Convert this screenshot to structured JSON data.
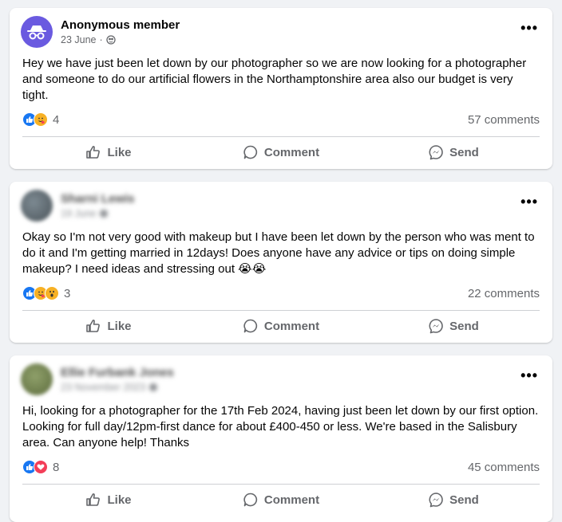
{
  "posts": [
    {
      "author": "Anonymous member",
      "date": "23 June",
      "body": "Hey we have just been let down by our photographer so we are now looking for a photographer and someone to do our artificial flowers in the Northamptonshire area also our budget is very tight.",
      "reaction_count": "4",
      "comments": "57 comments"
    },
    {
      "author": "Sharni Lewis",
      "date": "19 June",
      "body": "Okay so I'm not very good with makeup but I have been let down by the person who was ment to do it and I'm getting married in 12days! Does anyone have any advice or tips on doing simple makeup? I need ideas and stressing out 😭😭",
      "reaction_count": "3",
      "comments": "22 comments"
    },
    {
      "author": "Ellie Furbank Jones",
      "date": "23 November 2023",
      "body": "Hi, looking for a photographer for the 17th Feb 2024, having just been let down by our first option. Looking for full day/12pm-first dance for about £400-450 or less. We're based in the Salisbury area. Can anyone help! Thanks",
      "reaction_count": "8",
      "comments": "45 comments"
    }
  ],
  "actions": {
    "like": "Like",
    "comment": "Comment",
    "send": "Send"
  },
  "more_label": "•••",
  "separator": "·",
  "icons": {
    "anonymous": "anonymous-incognito-icon",
    "privacy": "globe-icon",
    "like": "thumbs-up-icon",
    "comment": "speech-bubble-icon",
    "send": "messenger-icon"
  },
  "colors": {
    "background": "#f0f2f5",
    "card": "#ffffff",
    "secondary_text": "#65676b",
    "like_blue": "#1877f2",
    "love_red": "#f33e58",
    "anon_purple": "#6a5ae0"
  }
}
